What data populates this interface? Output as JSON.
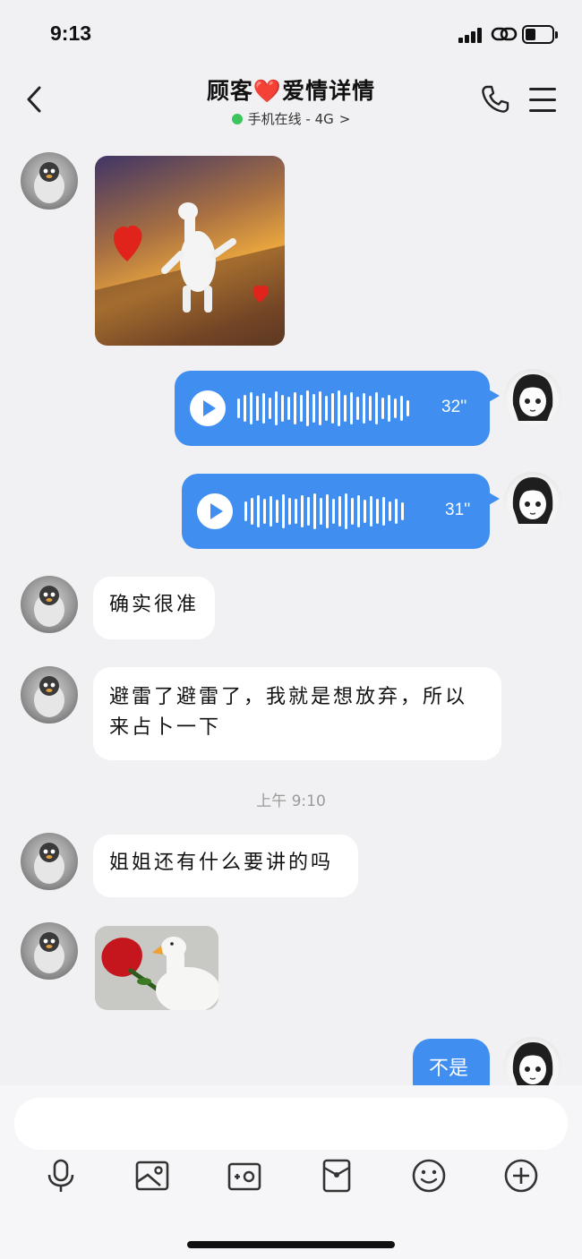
{
  "status_bar": {
    "time": "9:13"
  },
  "header": {
    "title_prefix": "顾客",
    "title_heart": "❤️",
    "title_suffix": "爱情详情",
    "status_text": "手机在线 - 4G",
    "status_chevron": ">"
  },
  "messages": {
    "voice_1_duration": "32''",
    "voice_2_duration": "31''",
    "text_1": "确实很准",
    "text_2_line1": "避雷了避雷了，我就是想放弃，所以",
    "text_2_line2": "来占卜一下",
    "time_separator": "上午 9:10",
    "text_3": "姐姐还有什么要讲的吗",
    "reply": "不是"
  },
  "input": {
    "value": "",
    "placeholder": ""
  },
  "toolbar_icons": [
    "microphone-icon",
    "image-icon",
    "camera-icon",
    "red-packet-icon",
    "emoji-icon",
    "plus-icon"
  ],
  "colors": {
    "bubble_blue": "#3f8ef0",
    "background": "#f1f1f3",
    "online_green": "#3cc45e"
  }
}
